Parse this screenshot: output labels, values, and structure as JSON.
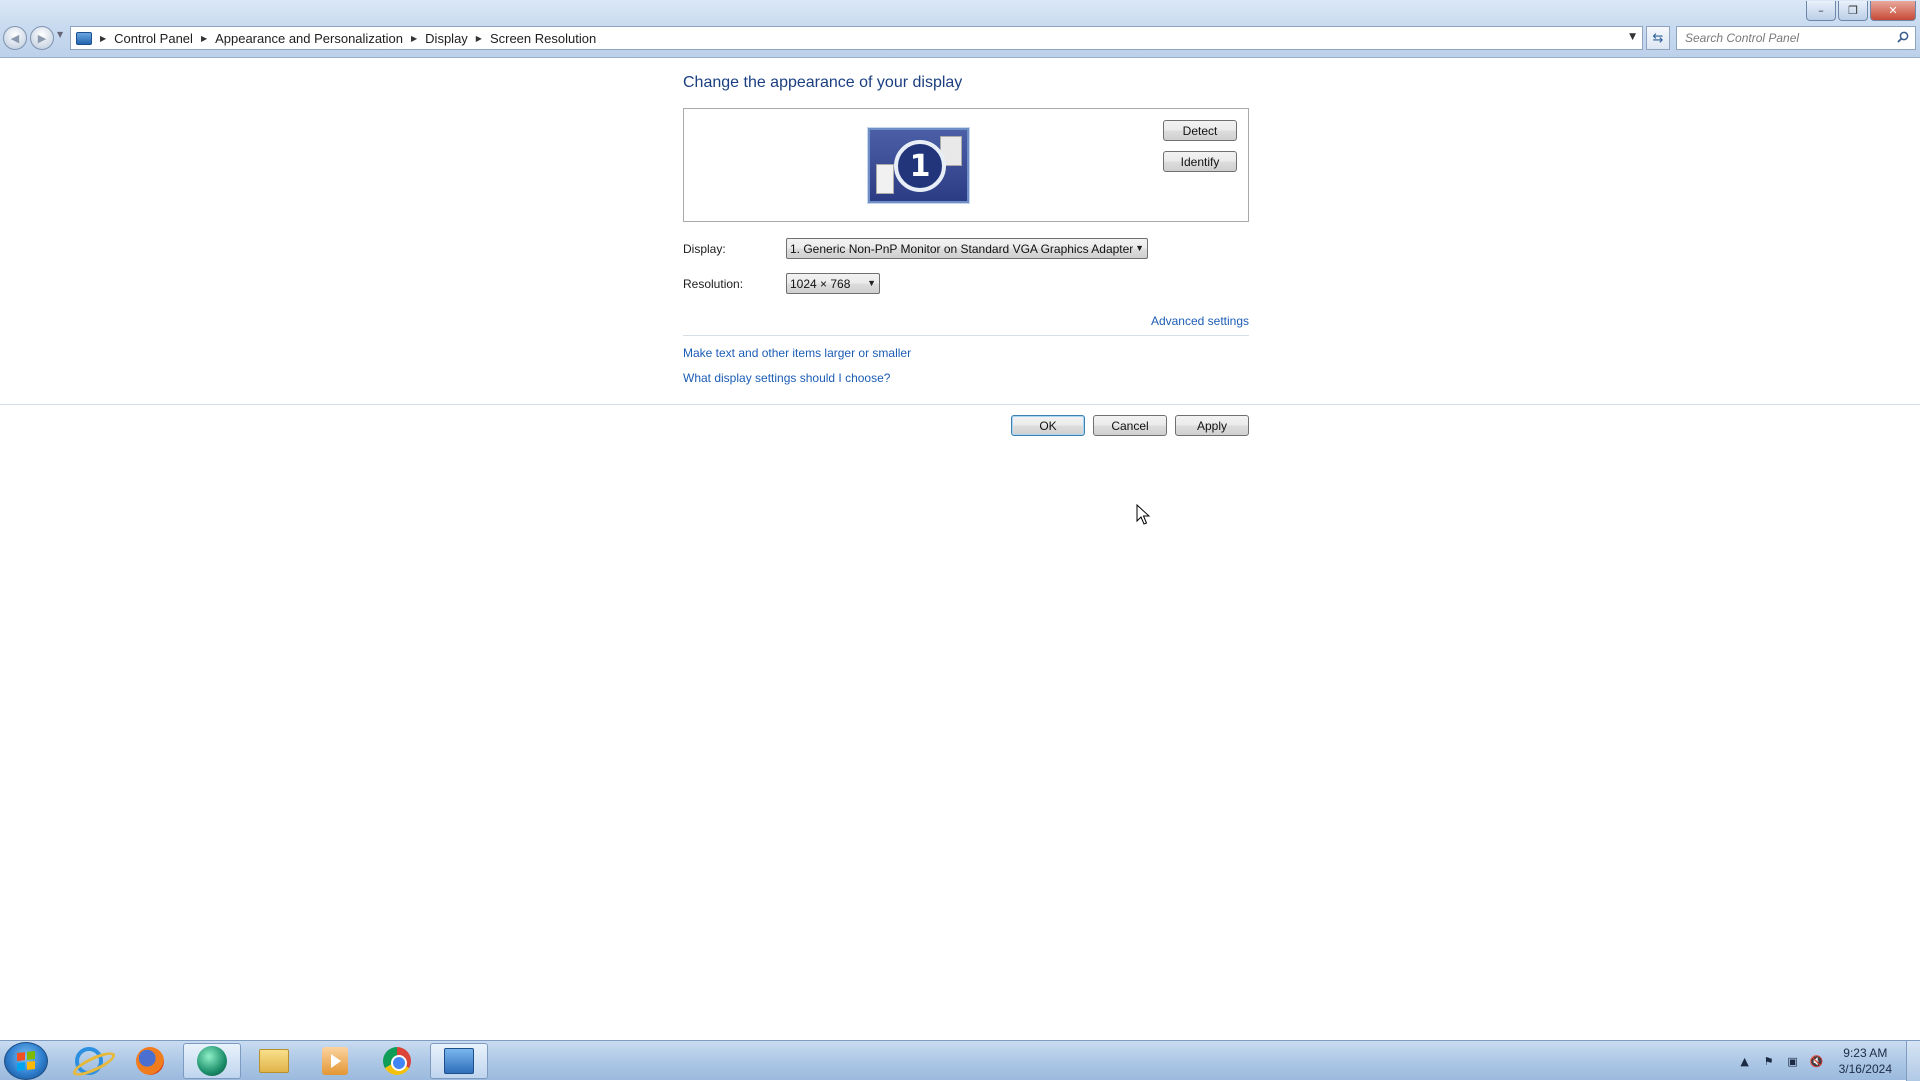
{
  "window": {
    "caption_buttons": {
      "minimize": "–",
      "restore": "❐",
      "close": "✕"
    }
  },
  "navigation": {
    "back_icon": "back-arrow-icon",
    "forward_icon": "forward-arrow-icon",
    "breadcrumb": [
      "Control Panel",
      "Appearance and Personalization",
      "Display",
      "Screen Resolution"
    ]
  },
  "search": {
    "placeholder": "Search Control Panel"
  },
  "main": {
    "title": "Change the appearance of your display",
    "monitor_number": "1",
    "detect_label": "Detect",
    "identify_label": "Identify",
    "display_label": "Display:",
    "display_value": "1. Generic Non-PnP Monitor on Standard VGA Graphics Adapter",
    "resolution_label": "Resolution:",
    "resolution_value": "1024 × 768",
    "advanced_link": "Advanced settings",
    "text_size_link": "Make text and other items larger or smaller",
    "help_link": "What display settings should I choose?"
  },
  "dialog_buttons": {
    "ok": "OK",
    "cancel": "Cancel",
    "apply": "Apply"
  },
  "taskbar": {
    "apps": [
      "internet-explorer",
      "firefox",
      "teamviewer-like-app",
      "file-explorer",
      "media-player",
      "chrome",
      "control-panel"
    ],
    "clock_time": "9:23 AM",
    "clock_date": "3/16/2024"
  },
  "colors": {
    "link": "#1c5db5",
    "title": "#1b3f80",
    "taskbar": "#aec8e6"
  }
}
